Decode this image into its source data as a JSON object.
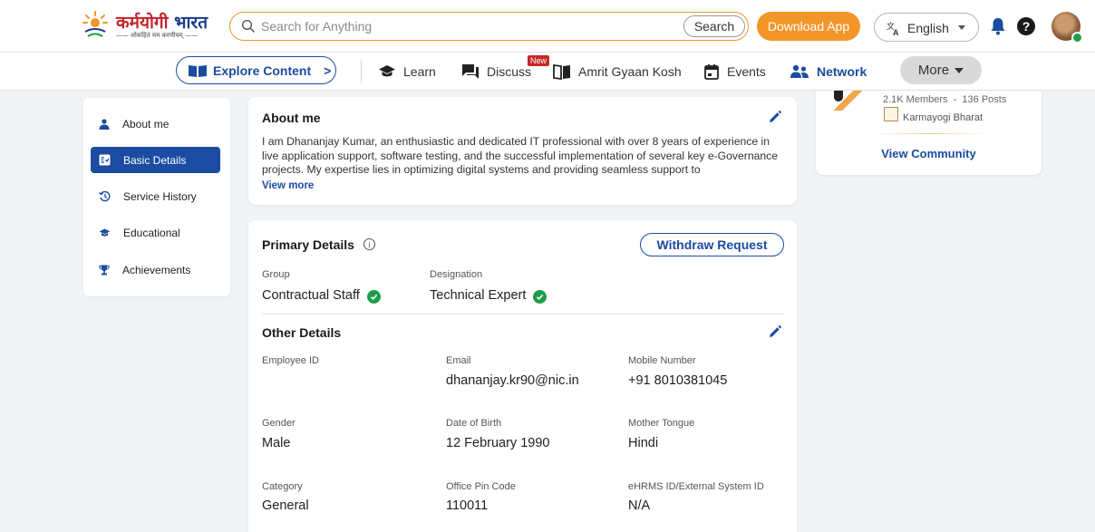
{
  "colors": {
    "primary": "#1b4ca1",
    "accent": "#f3962a",
    "success": "#1e9e4a",
    "new_badge": "#c62828",
    "page_bg": "#f1f3f5"
  },
  "header": {
    "logo_text_1": "कर्मयोगी",
    "logo_text_2": "भारत",
    "logo_tagline": "—— लोकहितं मम करणीयम् ——",
    "search_placeholder": "Search for Anything",
    "search_button": "Search",
    "download_app": "Download App",
    "language": "English",
    "icons": [
      "search-icon",
      "translate-icon",
      "bell-icon",
      "help-icon",
      "avatar"
    ]
  },
  "nav": {
    "explore": "Explore Content",
    "explore_arrow": ">",
    "items": [
      {
        "label": "Learn",
        "icon": "graduation-cap-icon"
      },
      {
        "label": "Discuss",
        "icon": "chat-icon",
        "badge": "New"
      },
      {
        "label": "Amrit Gyaan Kosh",
        "icon": "book-icon"
      },
      {
        "label": "Events",
        "icon": "calendar-icon"
      },
      {
        "label": "Network",
        "icon": "people-icon"
      }
    ],
    "more": "More"
  },
  "sidebar": {
    "items": [
      {
        "label": "About me",
        "icon": "person-icon",
        "active": false
      },
      {
        "label": "Basic Details",
        "icon": "id-card-icon",
        "active": true
      },
      {
        "label": "Service History",
        "icon": "history-icon",
        "active": false
      },
      {
        "label": "Educational",
        "icon": "graduation-cap-icon",
        "active": false
      },
      {
        "label": "Achievements",
        "icon": "trophy-icon",
        "active": false
      }
    ]
  },
  "about": {
    "title": "About me",
    "text": "I am Dhananjay Kumar, an enthusiastic and dedicated IT professional with over 8 years of experience in live application support, software testing, and the successful implementation of several key e-Governance projects. My expertise lies in optimizing digital systems and providing seamless support to",
    "view_more": "View more"
  },
  "primary": {
    "title": "Primary Details",
    "info": "i",
    "withdraw": "Withdraw Request",
    "fields": [
      {
        "label": "Group",
        "value": "Contractual Staff",
        "verified": true
      },
      {
        "label": "Designation",
        "value": "Technical Expert",
        "verified": true
      }
    ]
  },
  "other": {
    "title": "Other Details",
    "fields": [
      {
        "label": "Employee ID",
        "value": ""
      },
      {
        "label": "Email",
        "value": "dhananjay.kr90@nic.in"
      },
      {
        "label": "Mobile Number",
        "value": "+91 8010381045"
      },
      {
        "label": "Gender",
        "value": "Male"
      },
      {
        "label": "Date of Birth",
        "value": "12 February 1990"
      },
      {
        "label": "Mother Tongue",
        "value": "Hindi"
      },
      {
        "label": "Category",
        "value": "General"
      },
      {
        "label": "Office Pin Code",
        "value": "110011"
      },
      {
        "label": "eHRMS ID/External System ID",
        "value": "N/A"
      }
    ]
  },
  "community": {
    "stats": "2.1K Members  -  136 Posts",
    "org": "Karmayogi Bharat",
    "view": "View Community"
  }
}
